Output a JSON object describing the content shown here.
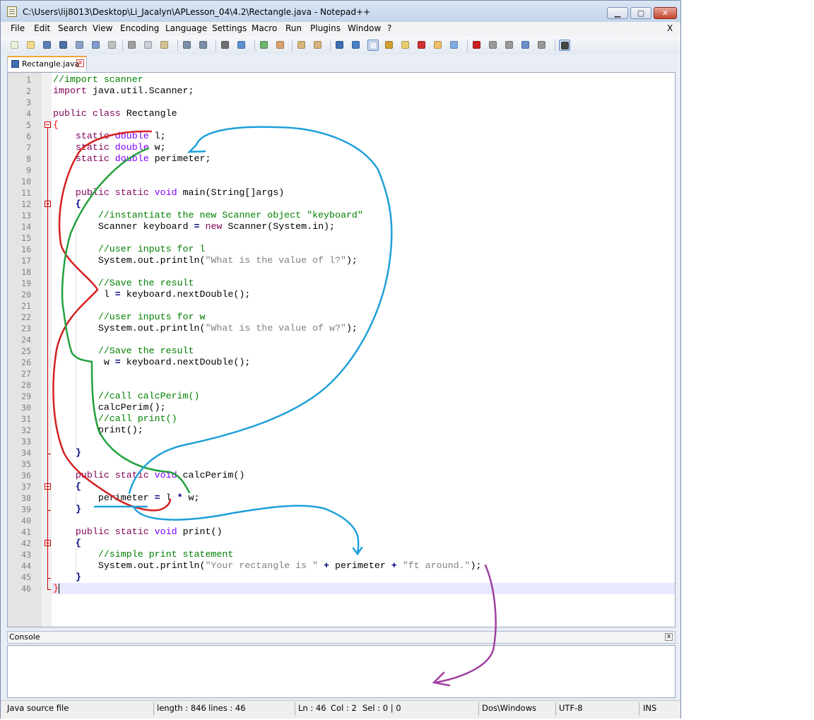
{
  "window": {
    "title": "C:\\Users\\lij8013\\Desktop\\Li_Jacalyn\\APLesson_04\\4.2\\Rectangle.java - Notepad++",
    "minimize_label": "▁",
    "maximize_label": "▢",
    "close_label": "✕"
  },
  "menu": {
    "items": [
      "File",
      "Edit",
      "Search",
      "View",
      "Encoding",
      "Language",
      "Settings",
      "Macro",
      "Run",
      "Plugins",
      "Window",
      "?"
    ],
    "close_label": "X"
  },
  "toolbar": {
    "icons": [
      "new-file-icon",
      "open-file-icon",
      "save-icon",
      "save-all-icon",
      "close-icon",
      "close-all-icon",
      "print-icon",
      "cut-icon",
      "copy-icon",
      "paste-icon",
      "undo-icon",
      "redo-icon",
      "find-icon",
      "replace-icon",
      "zoom-in-icon",
      "zoom-out-icon",
      "sync-vertical-icon",
      "sync-horizontal-icon",
      "word-wrap-icon",
      "show-all-chars-icon",
      "indent-guide-icon",
      "user-language-icon",
      "doc-map-icon",
      "function-list-icon",
      "folder-icon",
      "monitoring-icon",
      "record-macro-icon",
      "stop-macro-icon",
      "play-macro-icon",
      "run-macro-multiple-icon",
      "save-macro-icon",
      "console-icon"
    ]
  },
  "tab": {
    "label": "Rectangle.java",
    "close_label": "x"
  },
  "editor": {
    "line_numbers": [
      "1",
      "2",
      "3",
      "4",
      "5",
      "6",
      "7",
      "8",
      "9",
      "10",
      "11",
      "12",
      "13",
      "14",
      "15",
      "16",
      "17",
      "18",
      "19",
      "20",
      "21",
      "22",
      "23",
      "24",
      "25",
      "26",
      "27",
      "28",
      "29",
      "30",
      "31",
      "32",
      "33",
      "34",
      "35",
      "36",
      "37",
      "38",
      "39",
      "40",
      "41",
      "42",
      "43",
      "44",
      "45",
      "46"
    ],
    "lines": [
      [
        {
          "t": "//import scanner",
          "c": "cm"
        }
      ],
      [
        {
          "t": "import",
          "c": "kw"
        },
        {
          "t": " java.util.Scanner;",
          "c": ""
        }
      ],
      [],
      [
        {
          "t": "public",
          "c": "kw"
        },
        {
          "t": " ",
          "c": ""
        },
        {
          "t": "class",
          "c": "kw"
        },
        {
          "t": " Rectangle",
          "c": ""
        }
      ],
      [
        {
          "t": "{",
          "c": "br"
        }
      ],
      [
        {
          "t": "    ",
          "c": ""
        },
        {
          "t": "static",
          "c": "kw"
        },
        {
          "t": " ",
          "c": ""
        },
        {
          "t": "double",
          "c": "ty"
        },
        {
          "t": " l;",
          "c": ""
        }
      ],
      [
        {
          "t": "    ",
          "c": ""
        },
        {
          "t": "static",
          "c": "kw"
        },
        {
          "t": " ",
          "c": ""
        },
        {
          "t": "double",
          "c": "ty"
        },
        {
          "t": " w;",
          "c": ""
        }
      ],
      [
        {
          "t": "    ",
          "c": ""
        },
        {
          "t": "static",
          "c": "kw"
        },
        {
          "t": " ",
          "c": ""
        },
        {
          "t": "double",
          "c": "ty"
        },
        {
          "t": " perimeter;",
          "c": ""
        }
      ],
      [],
      [],
      [
        {
          "t": "    ",
          "c": ""
        },
        {
          "t": "public",
          "c": "kw"
        },
        {
          "t": " ",
          "c": ""
        },
        {
          "t": "static",
          "c": "kw"
        },
        {
          "t": " ",
          "c": ""
        },
        {
          "t": "void",
          "c": "ty"
        },
        {
          "t": " main(String[]args)",
          "c": ""
        }
      ],
      [
        {
          "t": "    ",
          "c": ""
        },
        {
          "t": "{",
          "c": "op"
        }
      ],
      [
        {
          "t": "        ",
          "c": ""
        },
        {
          "t": "//instantiate the new Scanner object \"keyboard\"",
          "c": "cm"
        }
      ],
      [
        {
          "t": "        Scanner keyboard ",
          "c": ""
        },
        {
          "t": "=",
          "c": "op"
        },
        {
          "t": " ",
          "c": ""
        },
        {
          "t": "new",
          "c": "kw"
        },
        {
          "t": " Scanner(System.in);",
          "c": ""
        }
      ],
      [],
      [
        {
          "t": "        ",
          "c": ""
        },
        {
          "t": "//user inputs for l",
          "c": "cm"
        }
      ],
      [
        {
          "t": "        System.out.println(",
          "c": ""
        },
        {
          "t": "\"What is the value of l?\"",
          "c": "st"
        },
        {
          "t": ");",
          "c": ""
        }
      ],
      [],
      [
        {
          "t": "        ",
          "c": ""
        },
        {
          "t": "//Save the result",
          "c": "cm"
        }
      ],
      [
        {
          "t": "         l ",
          "c": ""
        },
        {
          "t": "=",
          "c": "op"
        },
        {
          "t": " keyboard.nextDouble();",
          "c": ""
        }
      ],
      [],
      [
        {
          "t": "        ",
          "c": ""
        },
        {
          "t": "//user inputs for w",
          "c": "cm"
        }
      ],
      [
        {
          "t": "        System.out.println(",
          "c": ""
        },
        {
          "t": "\"What is the value of w?\"",
          "c": "st"
        },
        {
          "t": ");",
          "c": ""
        }
      ],
      [],
      [
        {
          "t": "        ",
          "c": ""
        },
        {
          "t": "//Save the result",
          "c": "cm"
        }
      ],
      [
        {
          "t": "         w ",
          "c": ""
        },
        {
          "t": "=",
          "c": "op"
        },
        {
          "t": " keyboard.nextDouble();",
          "c": ""
        }
      ],
      [],
      [],
      [
        {
          "t": "        ",
          "c": ""
        },
        {
          "t": "//call calcPerim()",
          "c": "cm"
        }
      ],
      [
        {
          "t": "        calcPerim();",
          "c": ""
        }
      ],
      [
        {
          "t": "        ",
          "c": ""
        },
        {
          "t": "//call print()",
          "c": "cm"
        }
      ],
      [
        {
          "t": "        print();",
          "c": ""
        }
      ],
      [],
      [
        {
          "t": "    ",
          "c": ""
        },
        {
          "t": "}",
          "c": "op"
        }
      ],
      [],
      [
        {
          "t": "    ",
          "c": ""
        },
        {
          "t": "public",
          "c": "kw"
        },
        {
          "t": " ",
          "c": ""
        },
        {
          "t": "static",
          "c": "kw"
        },
        {
          "t": " ",
          "c": ""
        },
        {
          "t": "void",
          "c": "ty"
        },
        {
          "t": " calcPerim()",
          "c": ""
        }
      ],
      [
        {
          "t": "    ",
          "c": ""
        },
        {
          "t": "{",
          "c": "op"
        }
      ],
      [
        {
          "t": "        perimeter ",
          "c": ""
        },
        {
          "t": "=",
          "c": "op"
        },
        {
          "t": " l ",
          "c": ""
        },
        {
          "t": "*",
          "c": "op"
        },
        {
          "t": " w;",
          "c": ""
        }
      ],
      [
        {
          "t": "    ",
          "c": ""
        },
        {
          "t": "}",
          "c": "op"
        }
      ],
      [],
      [
        {
          "t": "    ",
          "c": ""
        },
        {
          "t": "public",
          "c": "kw"
        },
        {
          "t": " ",
          "c": ""
        },
        {
          "t": "static",
          "c": "kw"
        },
        {
          "t": " ",
          "c": ""
        },
        {
          "t": "void",
          "c": "ty"
        },
        {
          "t": " print()",
          "c": ""
        }
      ],
      [
        {
          "t": "    ",
          "c": ""
        },
        {
          "t": "{",
          "c": "op"
        }
      ],
      [
        {
          "t": "        ",
          "c": ""
        },
        {
          "t": "//simple print statement",
          "c": "cm"
        }
      ],
      [
        {
          "t": "        System.out.println(",
          "c": ""
        },
        {
          "t": "\"Your rectangle is \"",
          "c": "st"
        },
        {
          "t": " ",
          "c": ""
        },
        {
          "t": "+",
          "c": "op"
        },
        {
          "t": " perimeter ",
          "c": ""
        },
        {
          "t": "+",
          "c": "op"
        },
        {
          "t": " ",
          "c": ""
        },
        {
          "t": "\"ft around.\"",
          "c": "st"
        },
        {
          "t": ");",
          "c": ""
        }
      ],
      [
        {
          "t": "    ",
          "c": ""
        },
        {
          "t": "}",
          "c": "op"
        }
      ],
      [
        {
          "t": "}",
          "c": "br"
        }
      ]
    ],
    "colors": {
      "keyword": "#7f0055",
      "type": "#8000ff",
      "comment": "#008000",
      "string": "#808080",
      "operator": "#000080",
      "brace": "#ff0000",
      "caret_line": "#e8e8ff"
    }
  },
  "console": {
    "title": "Console",
    "close_label": "x"
  },
  "status": {
    "file_type": "Java source file",
    "length": "length : 846",
    "lines": "lines : 46",
    "ln": "Ln : 46",
    "col": "Col : 2",
    "sel": "Sel : 0 | 0",
    "eol": "Dos\\Windows",
    "encoding": "UTF-8",
    "mode": "INS"
  },
  "annotation_colors": {
    "red": "#d42020",
    "green": "#22a03c",
    "blue": "#1e9fd8",
    "purple": "#a040a0"
  }
}
